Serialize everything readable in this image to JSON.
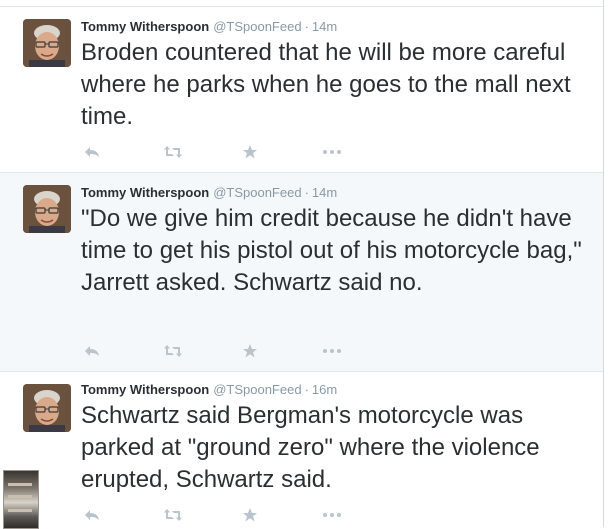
{
  "tweets": [
    {
      "name": "Tommy Witherspoon",
      "handle": "@TSpoonFeed",
      "separator": "·",
      "time": "14m",
      "text": "Broden countered that he  will be more careful where he parks when he goes to the mall next time.",
      "highlighted": false
    },
    {
      "name": "Tommy Witherspoon",
      "handle": "@TSpoonFeed",
      "separator": "·",
      "time": "14m",
      "text": "\"Do we give him credit because he didn't have time to get his pistol out of his motorcycle bag,\" Jarrett asked. Schwartz said no.",
      "highlighted": true
    },
    {
      "name": "Tommy Witherspoon",
      "handle": "@TSpoonFeed",
      "separator": "·",
      "time": "16m",
      "text": "Schwartz said Bergman's motorcycle was parked at \"ground zero\" where the violence erupted, Schwartz said.",
      "highlighted": false
    }
  ],
  "icons": {
    "reply": "reply-icon",
    "retweet": "retweet-icon",
    "favorite": "star-icon",
    "more": "more-icon"
  },
  "colors": {
    "name": "#292f33",
    "meta": "#8899a6",
    "action_icon": "#b9c4cc",
    "highlight_bg": "#f5f8fa",
    "divider": "#e1e8ed"
  }
}
